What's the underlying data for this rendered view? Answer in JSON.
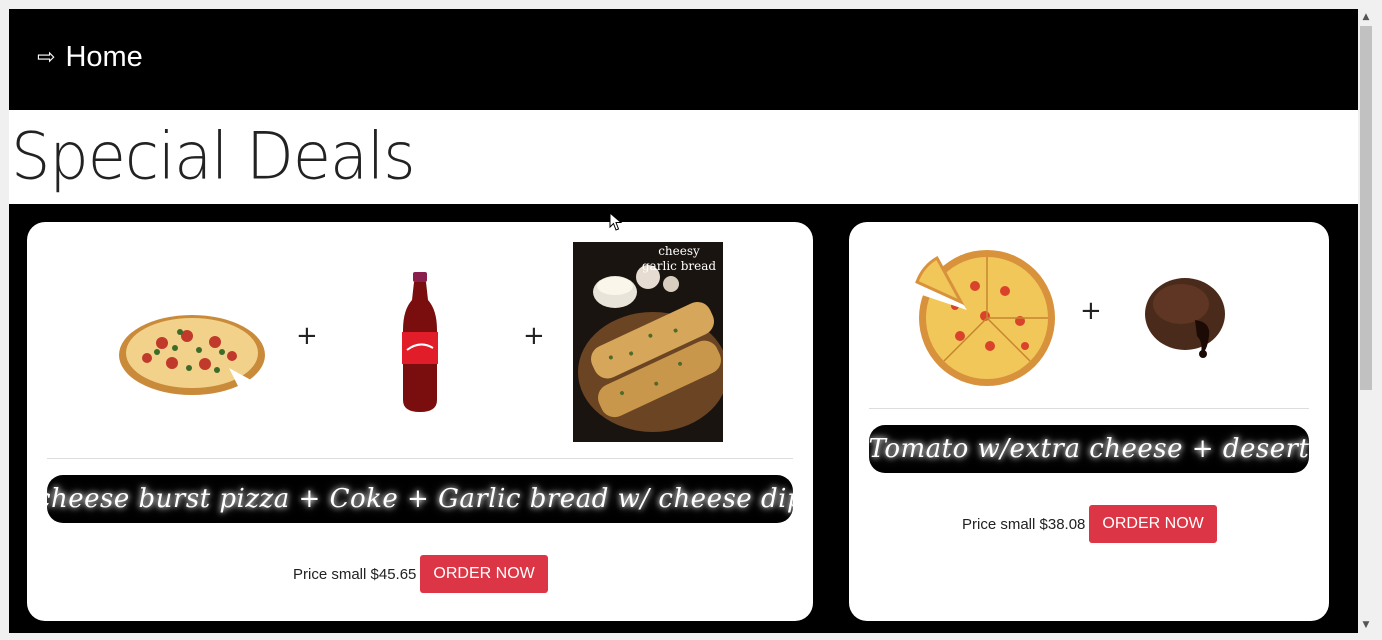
{
  "nav": {
    "arrow_glyph": "⇨",
    "home_label": "Home"
  },
  "page": {
    "title": "Special Deals"
  },
  "deals": [
    {
      "image_captions": [
        "cheesy garlic bread"
      ],
      "plus_1": "+",
      "plus_2": "+",
      "name": "cheese burst pizza + Coke + Garlic bread w/ cheese dip",
      "price_text": "Price small $45.65",
      "order_label": "ORDER NOW"
    },
    {
      "plus_1": "+",
      "name": "Tomato w/extra cheese + desert",
      "price_text": "Price small $38.08",
      "order_label": "ORDER NOW"
    }
  ],
  "colors": {
    "order_button": "#dc3545",
    "nav_background": "#000000"
  },
  "icons": [
    "arrow-right-icon",
    "pizza-image",
    "coke-bottle-image",
    "garlic-bread-image",
    "lava-cake-image"
  ]
}
